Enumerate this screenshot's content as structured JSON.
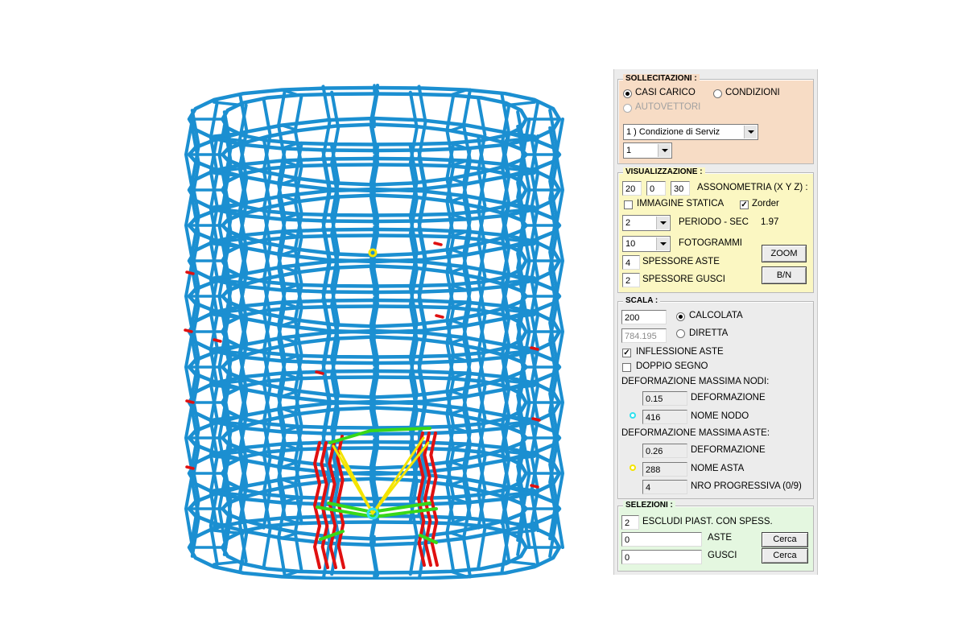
{
  "sollecitazioni": {
    "title": "SOLLECITAZIONI :",
    "casi_carico": "CASI CARICO",
    "condizioni": "CONDIZIONI",
    "autovettori": "AUTOVETTORI",
    "condizione_select": "1 ) Condizione di Serviz",
    "num_select": "1"
  },
  "visualizzazione": {
    "title": "VISUALIZZAZIONE :",
    "ax": "20",
    "ay": "0",
    "az": "30",
    "assonometria_label": "ASSONOMETRIA (X Y Z) :",
    "immagine_statica": "IMMAGINE STATICA",
    "zorder": "Zorder",
    "periodo_select": "2",
    "periodo_label": "PERIODO - SEC",
    "periodo_value": "1.97",
    "fotogrammi_select": "10",
    "fotogrammi_label": "FOTOGRAMMI",
    "spessore_aste_value": "4",
    "spessore_aste_label": "SPESSORE ASTE",
    "spessore_gusci_value": "2",
    "spessore_gusci_label": "SPESSORE GUSCI",
    "zoom_button": "ZOOM",
    "bn_button": "B/N"
  },
  "scala": {
    "title": "SCALA :",
    "calcolata_value": "200",
    "calcolata_label": "CALCOLATA",
    "diretta_value": "784.195",
    "diretta_label": "DIRETTA",
    "inflessione_aste": "INFLESSIONE ASTE",
    "doppio_segno": "DOPPIO SEGNO",
    "def_nodi_title": "DEFORMAZIONE MASSIMA NODI:",
    "nodi_deformazione_value": "0.15",
    "nodi_deformazione_label": "DEFORMAZIONE",
    "nodo_value": "416",
    "nodo_label": "NOME NODO",
    "def_aste_title": "DEFORMAZIONE MASSIMA ASTE:",
    "aste_deformazione_value": "0.26",
    "aste_deformazione_label": "DEFORMAZIONE",
    "asta_value": "288",
    "asta_label": "NOME ASTA",
    "progressiva_value": "4",
    "progressiva_label": "NRO PROGRESSIVA (0/9)"
  },
  "selezioni": {
    "title": "SELEZIONI :",
    "escludi_value": "2",
    "escludi_label": "ESCLUDI PIAST. CON SPESS.",
    "aste_value": "0",
    "aste_label": "ASTE",
    "gusci_value": "0",
    "gusci_label": "GUSCI",
    "cerca_aste": "Cerca",
    "cerca_gusci": "Cerca"
  },
  "colors": {
    "frame": "#1b8fd1",
    "max_aste": "#e01010",
    "braces": "#38d818",
    "diagonals": "#f4e400",
    "node_marker": "#30e0ee",
    "sollecitazioni_bg": "#f7dcc5",
    "visualizzazione_bg": "#fbf7c2",
    "scala_bg": "#ececec",
    "selezioni_bg": "#e4f7e0"
  }
}
